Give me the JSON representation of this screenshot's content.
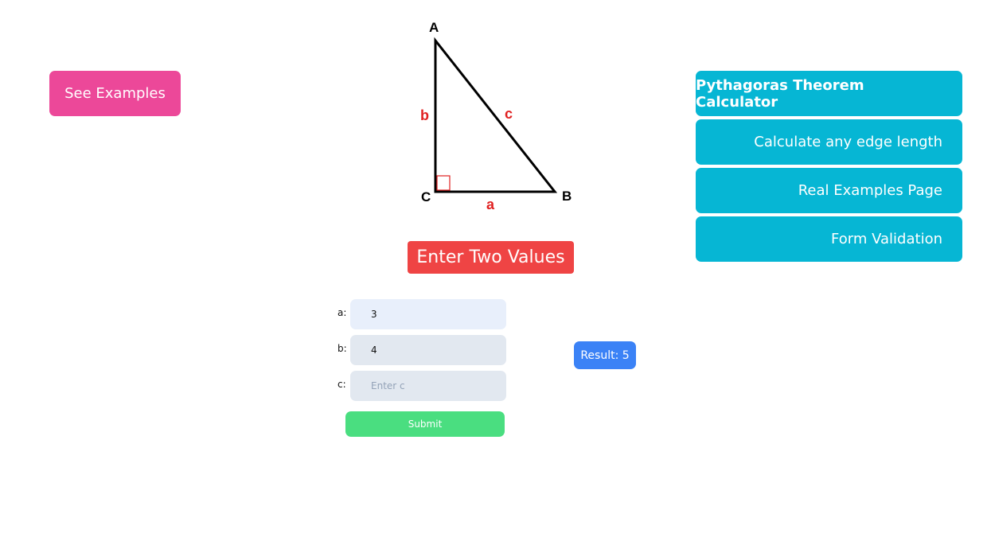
{
  "examples_button": {
    "label": "See Examples"
  },
  "diagram": {
    "vertex_a": "A",
    "vertex_b": "B",
    "vertex_c": "C",
    "side_a": "a",
    "side_b": "b",
    "side_c": "c",
    "label_color": "#e02020"
  },
  "heading": {
    "text": "Enter Two Values"
  },
  "menu": {
    "items": [
      {
        "label": "Pythagoras Theorem Calculator",
        "active": true
      },
      {
        "label": "Calculate any edge length"
      },
      {
        "label": "Real Examples Page"
      },
      {
        "label": "Form Validation"
      }
    ]
  },
  "form": {
    "a": {
      "label": "a:",
      "value": "3",
      "placeholder": "Enter a"
    },
    "b": {
      "label": "b:",
      "value": "4",
      "placeholder": "Enter b"
    },
    "c": {
      "label": "c:",
      "value": "",
      "placeholder": "Enter c"
    },
    "submit_label": "Submit"
  },
  "result": {
    "text": "Result: 5"
  },
  "colors": {
    "pink": "#ec4899",
    "red": "#ef4444",
    "cyan": "#06b6d4",
    "green": "#4ade80",
    "blue": "#3b82f6"
  }
}
